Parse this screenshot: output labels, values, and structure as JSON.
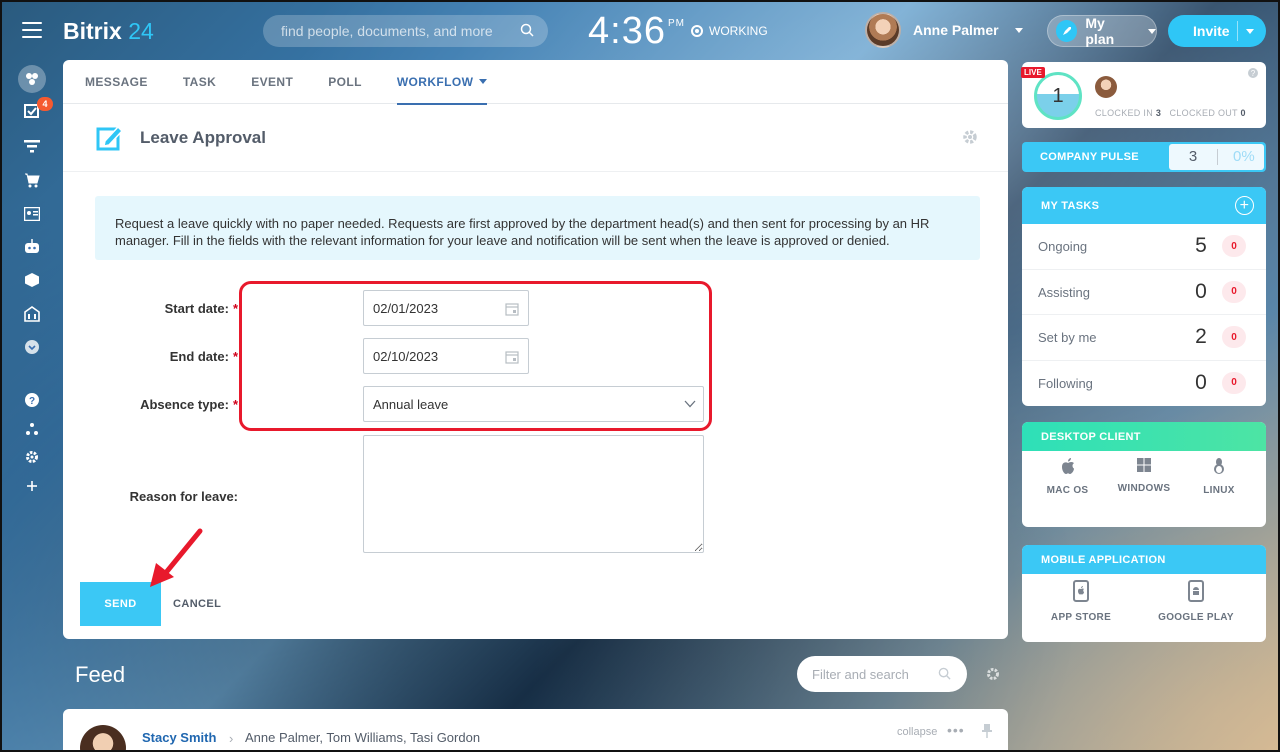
{
  "header": {
    "logo_text": "Bitrix",
    "logo_num": "24",
    "search_placeholder": "find people, documents, and more",
    "time": "4:36",
    "ampm": "PM",
    "status": "WORKING",
    "user_name": "Anne Palmer",
    "plan_label": "My plan",
    "invite_label": "Invite"
  },
  "sidebar": {
    "tasks_badge": "4"
  },
  "composer": {
    "tabs": [
      "MESSAGE",
      "TASK",
      "EVENT",
      "POLL",
      "WORKFLOW"
    ],
    "active_tab": "WORKFLOW",
    "title": "Leave Approval",
    "info": "Request a leave quickly with no paper needed. Requests are first approved by the department head(s) and then sent for processing by an HR manager. Fill in the fields with the relevant information for your leave and notification will be sent when the leave is approved or denied.",
    "fields": {
      "start_label": "Start date:",
      "start_value": "02/01/2023",
      "end_label": "End date:",
      "end_value": "02/10/2023",
      "absence_label": "Absence type:",
      "absence_value": "Annual leave",
      "reason_label": "Reason for leave:",
      "required_mark": "*"
    },
    "send_label": "SEND",
    "cancel_label": "CANCEL"
  },
  "feed": {
    "title": "Feed",
    "search_placeholder": "Filter and search",
    "post": {
      "author": "Stacy Smith",
      "recipients": "Anne Palmer, Tom Williams, Tasi Gordon",
      "collapse_label": "collapse"
    }
  },
  "right": {
    "live_label": "LIVE",
    "clocked_count": "1",
    "clocked_in_label": "CLOCKED IN",
    "clocked_in_value": "3",
    "clocked_out_label": "CLOCKED OUT",
    "clocked_out_value": "0",
    "pulse_label": "COMPANY PULSE",
    "pulse_value": "3",
    "pulse_percent": "0%",
    "tasks_title": "MY TASKS",
    "tasks": [
      {
        "name": "Ongoing",
        "count": "5",
        "overdue": "0"
      },
      {
        "name": "Assisting",
        "count": "0",
        "overdue": "0"
      },
      {
        "name": "Set by me",
        "count": "2",
        "overdue": "0"
      },
      {
        "name": "Following",
        "count": "0",
        "overdue": "0"
      }
    ],
    "desktop_title": "DESKTOP CLIENT",
    "desktop": [
      "MAC OS",
      "WINDOWS",
      "LINUX"
    ],
    "mobile_title": "MOBILE APPLICATION",
    "mobile": [
      "APP STORE",
      "GOOGLE PLAY"
    ]
  },
  "colors": {
    "accent": "#3bc8f5",
    "highlight": "#e8192c",
    "link": "#2067b0"
  }
}
